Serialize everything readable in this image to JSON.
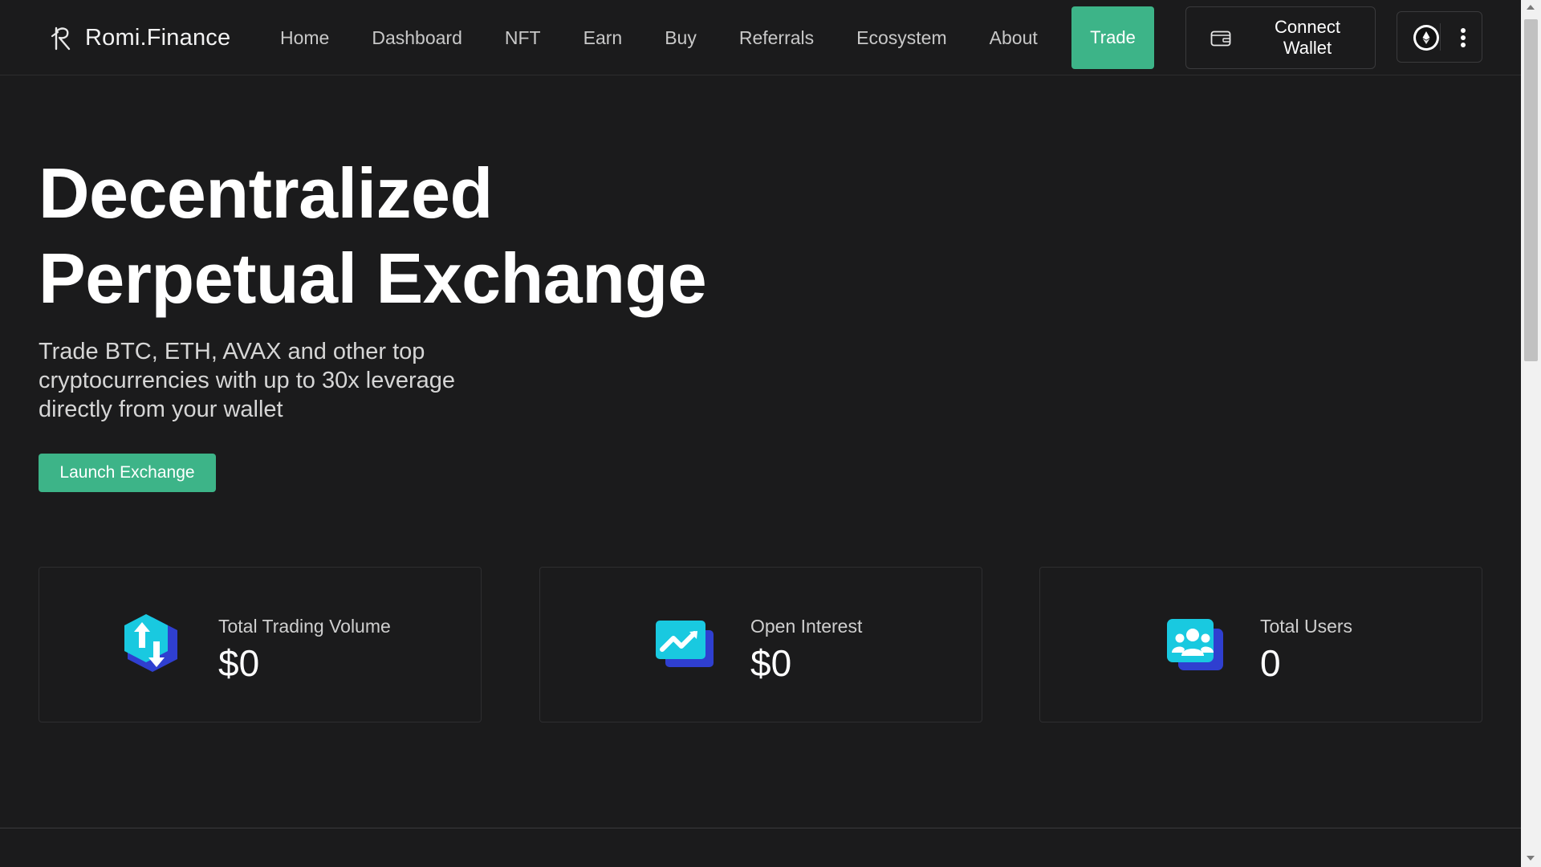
{
  "brand": {
    "name": "Romi.Finance"
  },
  "nav": {
    "items": [
      {
        "label": "Home"
      },
      {
        "label": "Dashboard"
      },
      {
        "label": "NFT"
      },
      {
        "label": "Earn"
      },
      {
        "label": "Buy"
      },
      {
        "label": "Referrals"
      },
      {
        "label": "Ecosystem"
      },
      {
        "label": "About"
      }
    ],
    "trade_label": "Trade"
  },
  "wallet": {
    "connect_label": "Connect\nWallet"
  },
  "hero": {
    "title_line1": "Decentralized",
    "title_line2": "Perpetual Exchange",
    "subtitle": "Trade BTC, ETH, AVAX and other top cryptocurrencies with up to 30x leverage directly from your wallet",
    "cta_label": "Launch Exchange"
  },
  "stats": [
    {
      "label": "Total Trading Volume",
      "value": "$0",
      "icon": "trading-volume-icon"
    },
    {
      "label": "Open Interest",
      "value": "$0",
      "icon": "open-interest-icon"
    },
    {
      "label": "Total Users",
      "value": "0",
      "icon": "users-icon"
    }
  ],
  "colors": {
    "background": "#1b1b1c",
    "accent": "#3db488",
    "icon_cyan": "#19c9e0",
    "icon_blue": "#2f3fd0"
  }
}
